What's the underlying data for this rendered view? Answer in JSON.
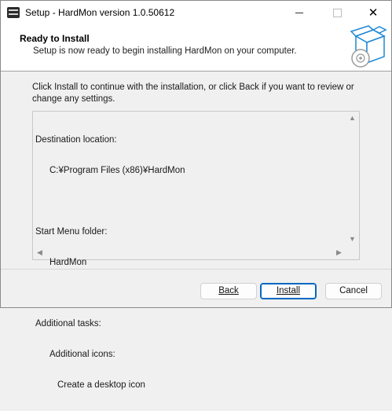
{
  "window": {
    "title": "Setup - HardMon version 1.0.50612"
  },
  "header": {
    "title": "Ready to Install",
    "subtitle": "Setup is now ready to begin installing HardMon on your computer."
  },
  "intro_text": "Click Install to continue with the installation, or click Back if you want to review or change any settings.",
  "memo": {
    "destination_label": "Destination location:",
    "destination_value": "C:¥Program Files (x86)¥HardMon",
    "start_menu_label": "Start Menu folder:",
    "start_menu_value": "HardMon",
    "tasks_label": "Additional tasks:",
    "tasks_group": "Additional icons:",
    "tasks_item": "Create a desktop icon"
  },
  "buttons": {
    "back": "Back",
    "install": "Install",
    "cancel": "Cancel"
  },
  "icons": [
    "app-icon",
    "minimize-icon",
    "maximize-icon",
    "close-icon",
    "box-disc-icon",
    "scroll-up-icon",
    "scroll-down-icon",
    "scroll-left-icon",
    "scroll-right-icon"
  ],
  "colors": {
    "accent": "#0067c0",
    "graphic_blue": "#1e88d8"
  }
}
